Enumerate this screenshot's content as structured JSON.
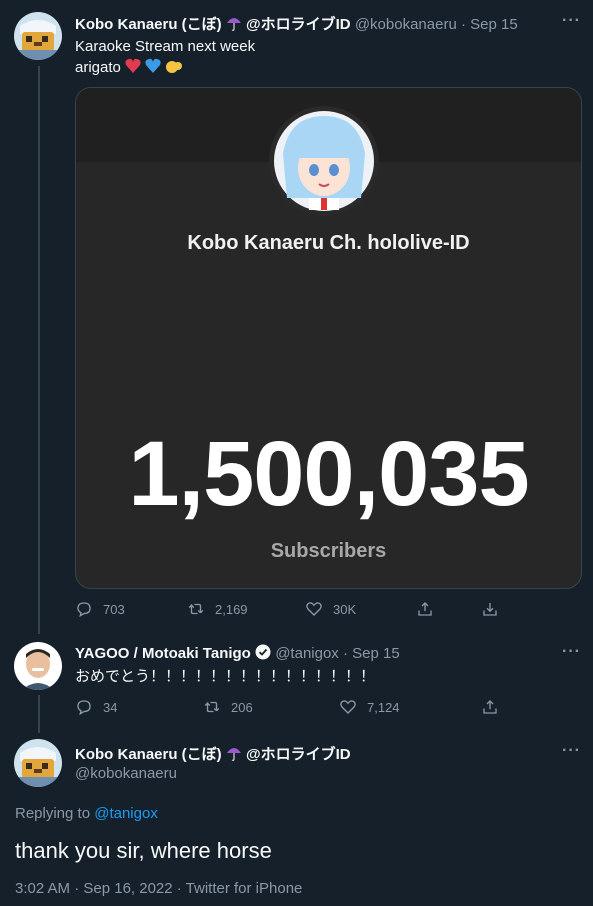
{
  "tweet1": {
    "display_name": "Kobo Kanaeru (こぼ)",
    "name_suffix": "@ホロライブID",
    "handle": "@kobokanaeru",
    "time": "· Sep 15",
    "text_line1": "Karaoke Stream next week",
    "text_line2": "arigato",
    "card": {
      "channel_name": "Kobo Kanaeru Ch. hololive-ID",
      "subscriber_count": "1,500,035",
      "subscriber_label": "Subscribers"
    },
    "actions": {
      "replies": "703",
      "retweets": "2,169",
      "likes": "30K"
    }
  },
  "tweet2": {
    "display_name": "YAGOO / Motoaki Tanigo",
    "handle": "@tanigox",
    "time": "· Sep 15",
    "text": "おめでとう！！！！！！！！！！！！！！！",
    "actions": {
      "replies": "34",
      "retweets": "206",
      "likes": "7,124"
    }
  },
  "tweet3": {
    "display_name": "Kobo Kanaeru (こぼ)",
    "name_suffix": "@ホロライブID",
    "handle": "@kobokanaeru",
    "replying_prefix": "Replying to",
    "replying_to": "@tanigox",
    "text": "thank you sir, where horse",
    "meta": "3:02 AM · Sep 16, 2022 · Twitter for iPhone"
  },
  "icons": [
    "umbrella-icon",
    "more-icon",
    "reply-icon",
    "retweet-icon",
    "like-icon",
    "share-icon",
    "bookmark-icon",
    "verified-icon"
  ],
  "colors": {
    "background": "#15202b",
    "accent": "#1d9bf0",
    "muted": "#8b98a5",
    "card": "#272727"
  }
}
